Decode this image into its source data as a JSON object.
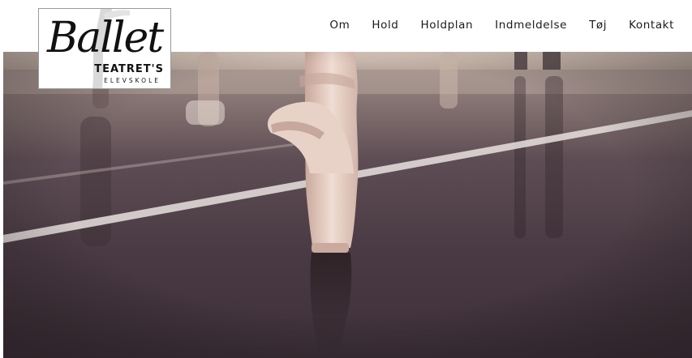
{
  "logo": {
    "script_text": "Ballet",
    "line1": "TEATRET'S",
    "line2": "ELEVSKOLE"
  },
  "nav": {
    "items": [
      {
        "label": "Om"
      },
      {
        "label": "Hold"
      },
      {
        "label": "Holdplan"
      },
      {
        "label": "Indmeldelse"
      },
      {
        "label": "Tøj"
      },
      {
        "label": "Kontakt"
      }
    ]
  },
  "hero": {
    "image_icon": "ballet-pointe-shoe-photo"
  }
}
